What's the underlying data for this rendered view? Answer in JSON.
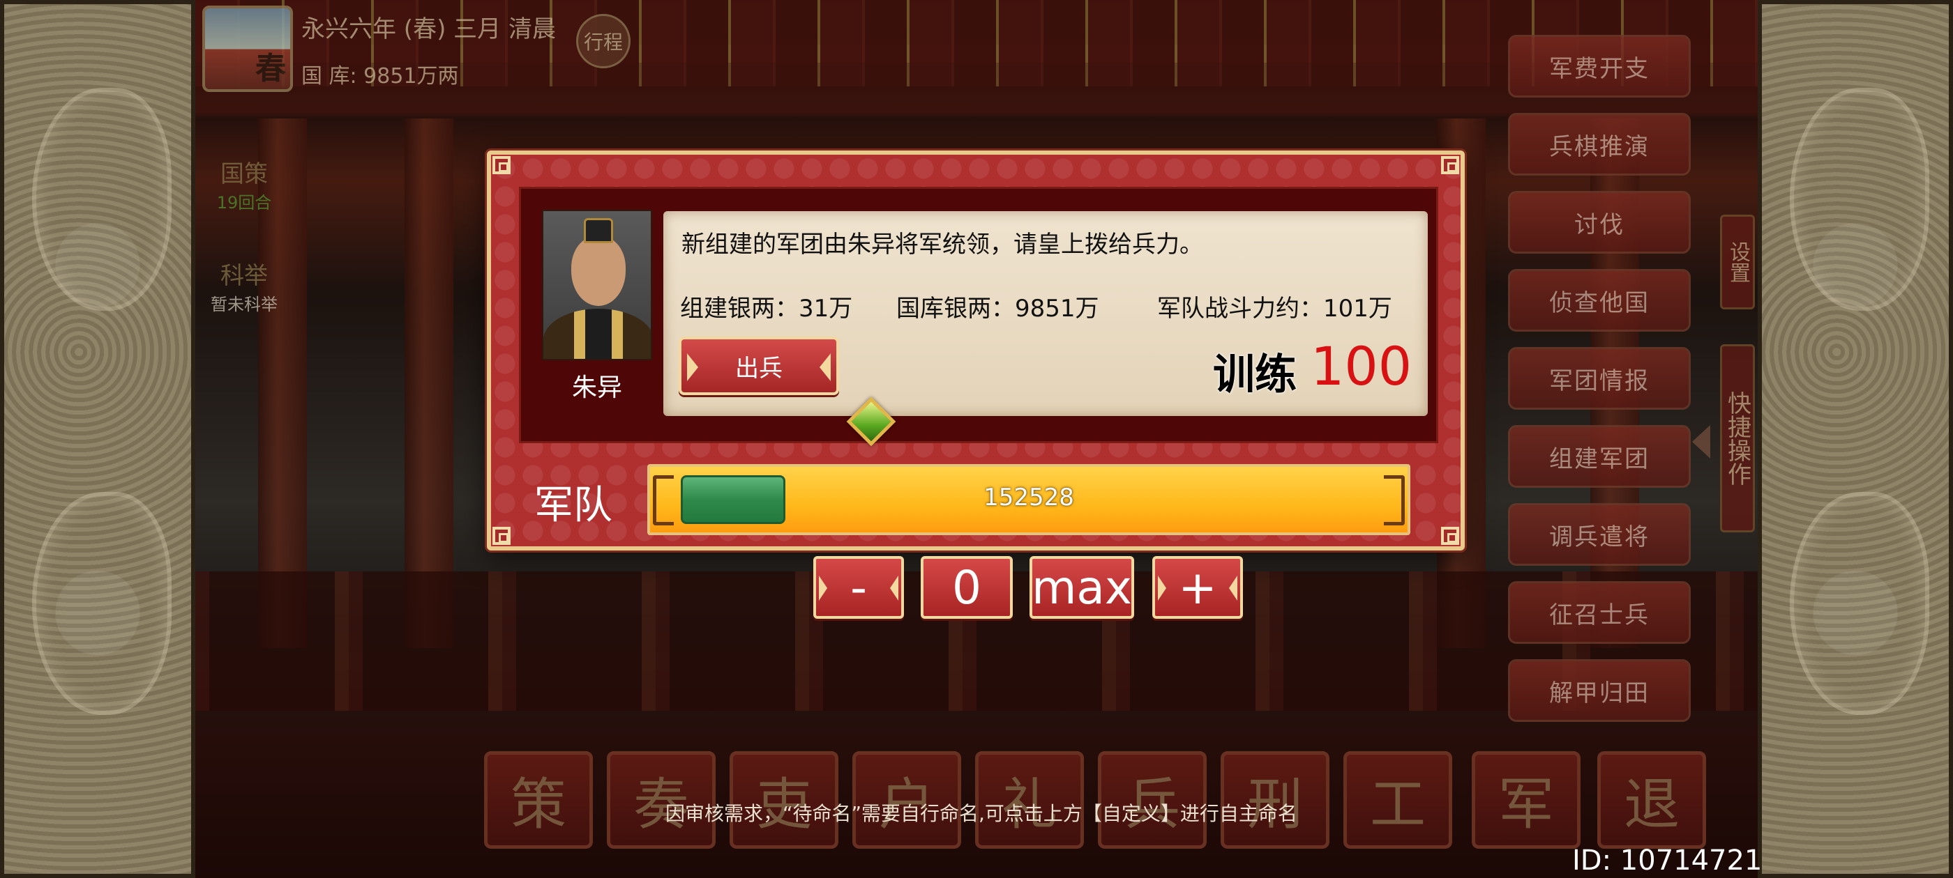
{
  "status": {
    "season": "春",
    "date": "永兴六年 (春) 三月 清晨",
    "treasury": "国 库: 9851万两",
    "schedule_label": "行程"
  },
  "left_tags": [
    {
      "title": "国策",
      "sub": "19回合",
      "sub_color": "#4e8a2e"
    },
    {
      "title": "科举",
      "sub": "暂未科举",
      "sub_color": "#bfb7a6"
    }
  ],
  "right_menu": [
    "军费开支",
    "兵棋推演",
    "讨伐",
    "侦查他国",
    "军团情报",
    "组建军团",
    "调兵遣将",
    "征召士兵",
    "解甲归田"
  ],
  "vertical_tabs": {
    "settings": "设置",
    "quick_ops": "快捷操作"
  },
  "bottom_bar": [
    "策",
    "奏",
    "吏",
    "户",
    "礼",
    "兵",
    "刑",
    "工",
    "军",
    "退"
  ],
  "notice": "因审核需求，“待命名”需要自行命名,可点击上方【自定义】进行自主命名",
  "user_id": "ID: 10714721",
  "dialog": {
    "general_name": "朱异",
    "message": "新组建的军团由朱异将军统领，请皇上拨给兵力。",
    "stats": [
      "组建银两：31万",
      "国库银两：9851万",
      "军队战斗力约：101万"
    ],
    "dispatch_label": "出兵",
    "train_label": "训练",
    "train_value": "100",
    "army_label": "军队",
    "army_count": "152528",
    "army_fill_fraction": 0.15
  },
  "quantity": {
    "minus": "-",
    "value": "0",
    "max": "max",
    "plus": "+"
  },
  "colors": {
    "dialog_bg": "#b03030",
    "dialog_border": "#e9c98c",
    "train_value": "#d81212",
    "bar_fill": "#2e8a4a",
    "bar_bg": "#ffb81a"
  }
}
